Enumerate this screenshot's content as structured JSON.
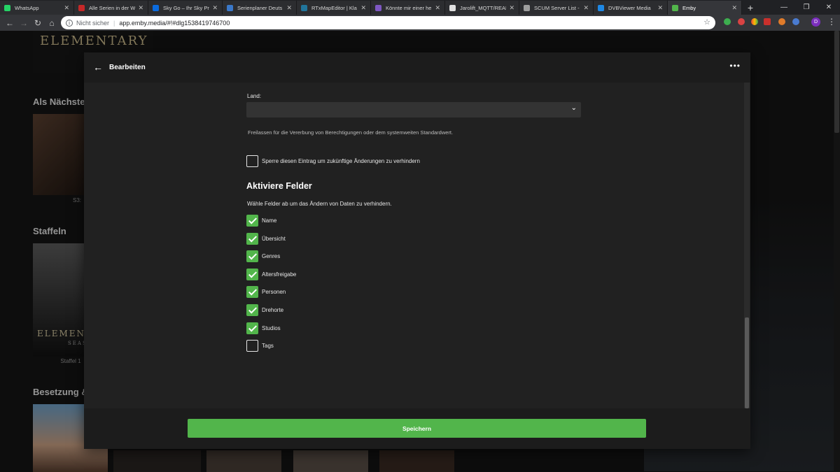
{
  "browser": {
    "tabs": [
      {
        "title": "WhatsApp",
        "color": "#25d366"
      },
      {
        "title": "Alle Serien in der W",
        "color": "#c62828"
      },
      {
        "title": "Sky Go – Ihr Sky Pr",
        "color": "#0b6bde"
      },
      {
        "title": "Serienplaner Deuts",
        "color": "#3a78c9"
      },
      {
        "title": "RTxMapEditor | Kla",
        "color": "#21759b"
      },
      {
        "title": "Könnte mir einer he",
        "color": "#7e57c2"
      },
      {
        "title": "Jarolift_MQTT/REAL",
        "color": "#e0e0e0"
      },
      {
        "title": "SCUM Server List -",
        "color": "#9e9e9e"
      },
      {
        "title": "DVBViewer Media",
        "color": "#1e88e5"
      },
      {
        "title": "Emby",
        "color": "#52b54b"
      }
    ],
    "tab_close": "✕",
    "new_tab": "+",
    "window_controls": [
      "—",
      "❐",
      "✕"
    ],
    "address": {
      "security_label": "Nicht sicher",
      "url": "app.emby.media/#!#dlg1538419746700"
    },
    "profile_letter": "D"
  },
  "page": {
    "poster_top_title": "ELEMENTARY",
    "section_next": "Als Nächste",
    "next_caption": "S3:",
    "section_seasons": "Staffeln",
    "season_poster_title": "ELEMENT",
    "season_poster_sub": "SEAS",
    "season_caption": "Staffel 1",
    "section_cast": "Besetzung &"
  },
  "dialog": {
    "title": "Bearbeiten",
    "country_label": "Land:",
    "country_value": "",
    "help_text": "Freilassen für die Vererbung von Berechtigungen oder dem systemweiten Standardwert.",
    "lock_label": "Sperre diesen Eintrag um zukünftige Änderungen zu verhindern",
    "lock_checked": false,
    "section_title": "Aktiviere Felder",
    "section_desc": "Wähle Felder ab um das Ändern von Daten zu verhindern.",
    "fields": [
      {
        "label": "Name",
        "checked": true
      },
      {
        "label": "Übersicht",
        "checked": true
      },
      {
        "label": "Genres",
        "checked": true
      },
      {
        "label": "Altersfreigabe",
        "checked": true
      },
      {
        "label": "Personen",
        "checked": true
      },
      {
        "label": "Drehorte",
        "checked": true
      },
      {
        "label": "Studios",
        "checked": true
      },
      {
        "label": "Tags",
        "checked": false
      }
    ],
    "save_label": "Speichern"
  },
  "colors": {
    "accent": "#52b54b",
    "dialog_bg": "#212121",
    "header_bg": "#1c1c1c"
  }
}
